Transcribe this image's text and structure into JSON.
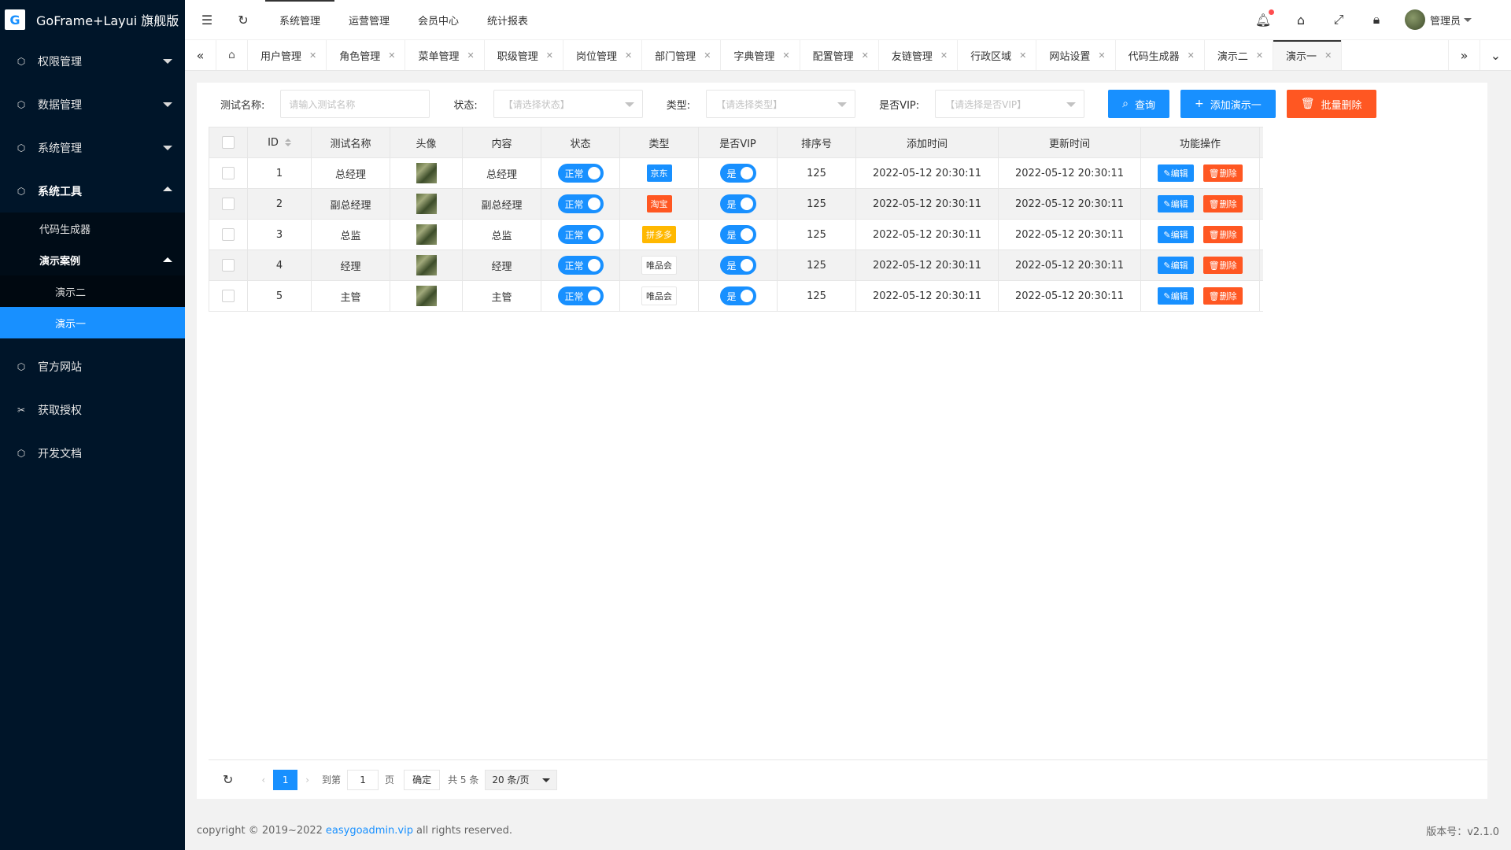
{
  "app": {
    "title": "GoFrame+Layui 旗舰版",
    "logo_glyph": "G"
  },
  "sidebar": {
    "items": [
      {
        "label": "权限管理",
        "icon": "cube-icon"
      },
      {
        "label": "数据管理",
        "icon": "cube-icon"
      },
      {
        "label": "系统管理",
        "icon": "cube-icon"
      },
      {
        "label": "系统工具",
        "icon": "cube-icon"
      }
    ],
    "sub": {
      "code_gen": "代码生成器",
      "demo_group": "演示案例"
    },
    "subsub": {
      "demo2": "演示二",
      "demo1": "演示一"
    },
    "bottom": [
      {
        "label": "官方网站",
        "icon": "cube-icon"
      },
      {
        "label": "获取授权",
        "icon": "tools-icon"
      },
      {
        "label": "开发文档",
        "icon": "cube-icon"
      }
    ]
  },
  "topnav": [
    "系统管理",
    "运营管理",
    "会员中心",
    "统计报表"
  ],
  "header": {
    "user": "管理员"
  },
  "tabs": [
    "用户管理",
    "角色管理",
    "菜单管理",
    "职级管理",
    "岗位管理",
    "部门管理",
    "字典管理",
    "配置管理",
    "友链管理",
    "行政区域",
    "网站设置",
    "代码生成器",
    "演示二",
    "演示一"
  ],
  "filters": {
    "name_label": "测试名称:",
    "name_placeholder": "请输入测试名称",
    "status_label": "状态:",
    "status_placeholder": "【请选择状态】",
    "type_label": "类型:",
    "type_placeholder": "【请选择类型】",
    "vip_label": "是否VIP:",
    "vip_placeholder": "【请选择是否VIP】",
    "search_btn": "查询",
    "add_btn": "添加演示一",
    "batch_delete_btn": "批量删除"
  },
  "table": {
    "headers": [
      "ID",
      "测试名称",
      "头像",
      "内容",
      "状态",
      "类型",
      "是否VIP",
      "排序号",
      "添加时间",
      "更新时间",
      "功能操作"
    ],
    "rows": [
      {
        "id": "1",
        "name": "总经理",
        "content": "总经理",
        "status": "正常",
        "type": "京东",
        "type_color": "blue",
        "vip": "是",
        "sort": "125",
        "created": "2022-05-12 20:30:11",
        "updated": "2022-05-12 20:30:11"
      },
      {
        "id": "2",
        "name": "副总经理",
        "content": "副总经理",
        "status": "正常",
        "type": "淘宝",
        "type_color": "orange",
        "vip": "是",
        "sort": "125",
        "created": "2022-05-12 20:30:11",
        "updated": "2022-05-12 20:30:11"
      },
      {
        "id": "3",
        "name": "总监",
        "content": "总监",
        "status": "正常",
        "type": "拼多多",
        "type_color": "yellow",
        "vip": "是",
        "sort": "125",
        "created": "2022-05-12 20:30:11",
        "updated": "2022-05-12 20:30:11"
      },
      {
        "id": "4",
        "name": "经理",
        "content": "经理",
        "status": "正常",
        "type": "唯品会",
        "type_color": "white",
        "vip": "是",
        "sort": "125",
        "created": "2022-05-12 20:30:11",
        "updated": "2022-05-12 20:30:11"
      },
      {
        "id": "5",
        "name": "主管",
        "content": "主管",
        "status": "正常",
        "type": "唯品会",
        "type_color": "white",
        "vip": "是",
        "sort": "125",
        "created": "2022-05-12 20:30:11",
        "updated": "2022-05-12 20:30:11"
      }
    ],
    "edit_label": "编辑",
    "delete_label": "删除"
  },
  "pager": {
    "current": "1",
    "goto_label": "到第",
    "goto_value": "1",
    "page_unit": "页",
    "confirm": "确定",
    "total": "共 5 条",
    "page_size": "20 条/页"
  },
  "footer": {
    "copyright": "copyright © 2019~2022",
    "link": "easygoadmin.vip",
    "rights": "all rights reserved.",
    "version": "版本号：v2.1.0"
  }
}
